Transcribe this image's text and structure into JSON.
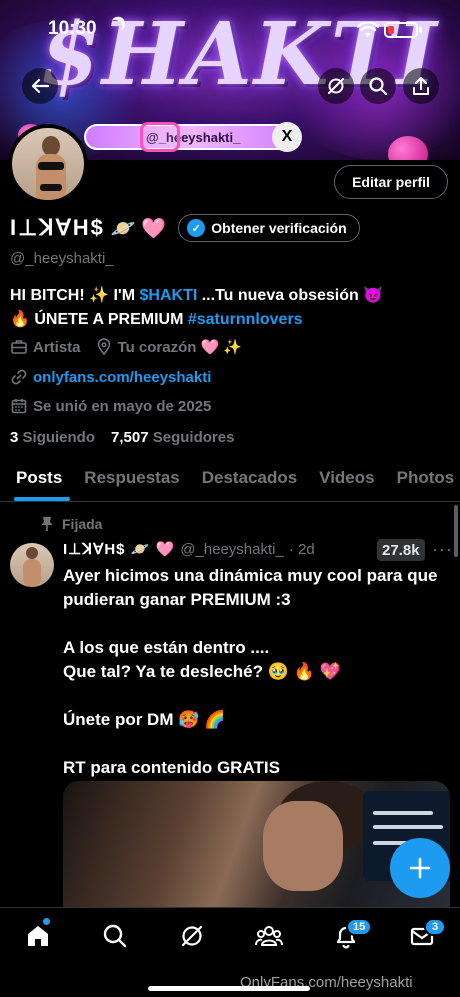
{
  "status_bar": {
    "time": "10:30"
  },
  "banner": {
    "title": "$HAKTI",
    "pill_handle": "@_heeyshakti_",
    "x_icon_text": "X"
  },
  "profile": {
    "edit_button": "Editar perfil",
    "display_name": "I⊥ꓘ∀H$",
    "name_emojis": "🪐 🩷",
    "verify_button": "Obtener verificación",
    "handle": "@_heeyshakti_",
    "bio_line1_a": "HI BITCH! ✨ I'M ",
    "bio_line1_hl": "$HAKTI",
    "bio_line1_b": " ...Tu nueva obsesión 😈",
    "bio_line2_a": "🔥 ÚNETE A PREMIUM ",
    "bio_line2_hl": "#saturnnlovers",
    "category": "Artista",
    "location": "Tu corazón 🩷 ✨",
    "link": "onlyfans.com/heeyshakti",
    "joined": "Se unió en mayo de 2025",
    "following_count": "3",
    "following_label": "Siguiendo",
    "followers_count": "7,507",
    "followers_label": "Seguidores"
  },
  "tabs": [
    "Posts",
    "Respuestas",
    "Destacados",
    "Videos",
    "Photos"
  ],
  "post": {
    "pinned_label": "Fijada",
    "name": "I⊥ꓘ∀H$ 🪐 🩷",
    "handle": "@_heeyshakti_",
    "time": "· 2d",
    "views": "27.8k",
    "text": "Ayer hicimos una dinámica muy cool para que pudieran ganar PREMIUM :3\n\nA los que están dentro ....\nQue tal? Ya te desleché? 🥹 🔥 💖\n\nÚnete por DM 🥵 🌈\n\nRT para contenido GRATIS"
  },
  "bottom_nav": {
    "communities_badge": "15",
    "messages_badge": "3"
  },
  "watermark": "OnlyFans.com/heeyshakti",
  "colors": {
    "accent": "#1d9bf0",
    "muted": "#71767b",
    "background": "#000000"
  }
}
